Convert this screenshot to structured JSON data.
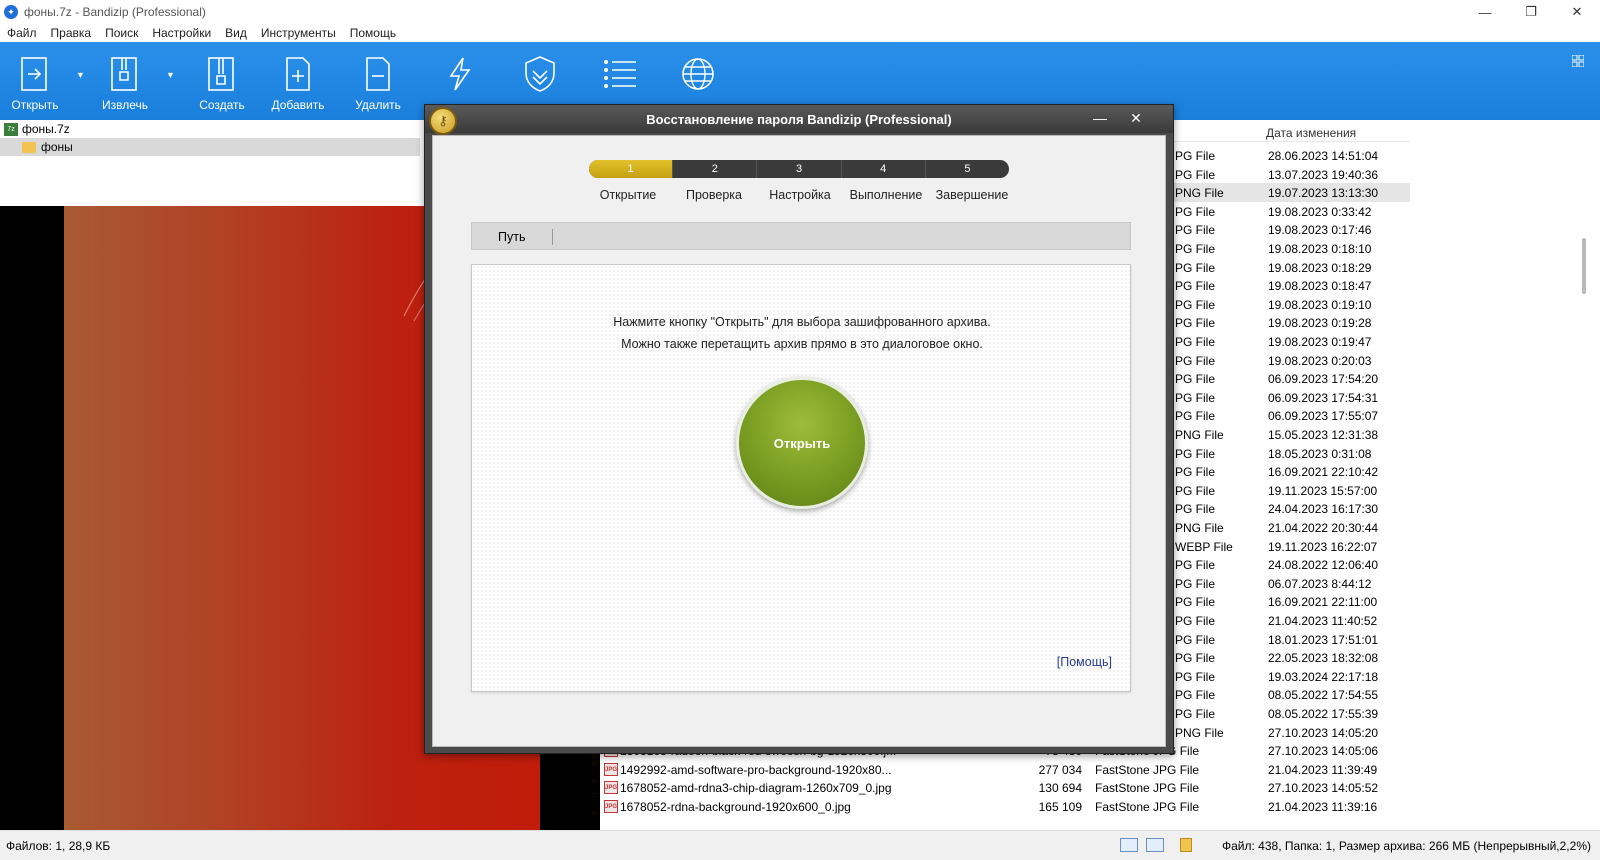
{
  "window": {
    "title": "фоны.7z - Bandizip (Professional)",
    "controls": {
      "minimize": "—",
      "restore": "❐",
      "close": "✕"
    }
  },
  "menu": [
    "Файл",
    "Правка",
    "Поиск",
    "Настройки",
    "Вид",
    "Инструменты",
    "Помощь"
  ],
  "toolbar": {
    "open": "Открыть",
    "extract": "Извлечь",
    "create": "Создать",
    "add": "Добавить",
    "delete": "Удалить"
  },
  "tree": {
    "archive": "фоны.7z",
    "folder": "фоны"
  },
  "filelist": {
    "date_header": "Дата изменения",
    "type_dates": [
      {
        "type": "PG File",
        "date": "28.06.2023 14:51:04"
      },
      {
        "type": "PG File",
        "date": "13.07.2023 19:40:36"
      },
      {
        "type": "PNG File",
        "date": "19.07.2023 13:13:30"
      },
      {
        "type": "PG File",
        "date": "19.08.2023 0:33:42"
      },
      {
        "type": "PG File",
        "date": "19.08.2023 0:17:46"
      },
      {
        "type": "PG File",
        "date": "19.08.2023 0:18:10"
      },
      {
        "type": "PG File",
        "date": "19.08.2023 0:18:29"
      },
      {
        "type": "PG File",
        "date": "19.08.2023 0:18:47"
      },
      {
        "type": "PG File",
        "date": "19.08.2023 0:19:10"
      },
      {
        "type": "PG File",
        "date": "19.08.2023 0:19:28"
      },
      {
        "type": "PG File",
        "date": "19.08.2023 0:19:47"
      },
      {
        "type": "PG File",
        "date": "19.08.2023 0:20:03"
      },
      {
        "type": "PG File",
        "date": "06.09.2023 17:54:20"
      },
      {
        "type": "PG File",
        "date": "06.09.2023 17:54:31"
      },
      {
        "type": "PG File",
        "date": "06.09.2023 17:55:07"
      },
      {
        "type": "PNG File",
        "date": "15.05.2023 12:31:38"
      },
      {
        "type": "PG File",
        "date": "18.05.2023 0:31:08"
      },
      {
        "type": "PG File",
        "date": "16.09.2021 22:10:42"
      },
      {
        "type": "PG File",
        "date": "19.11.2023 15:57:00"
      },
      {
        "type": "PG File",
        "date": "24.04.2023 16:17:30"
      },
      {
        "type": "PNG File",
        "date": "21.04.2022 20:30:44"
      },
      {
        "type": "WEBP File",
        "date": "19.11.2023 16:22:07"
      },
      {
        "type": "PG File",
        "date": "24.08.2022 12:06:40"
      },
      {
        "type": "PG File",
        "date": "06.07.2023 8:44:12"
      },
      {
        "type": "PG File",
        "date": "16.09.2021 22:11:00"
      },
      {
        "type": "PG File",
        "date": "21.04.2023 11:40:52"
      },
      {
        "type": "PG File",
        "date": "18.01.2023 17:51:01"
      },
      {
        "type": "PG File",
        "date": "22.05.2023 18:32:08"
      },
      {
        "type": "PG File",
        "date": "19.03.2024 22:17:18"
      },
      {
        "type": "PG File",
        "date": "08.05.2022 17:54:55"
      },
      {
        "type": "PG File",
        "date": "08.05.2022 17:55:39"
      },
      {
        "type": "PNG File",
        "date": "27.10.2023 14:05:20"
      }
    ],
    "full_rows": [
      {
        "name": "1303168-radeon-black-red-swoosh-bg-1920x800.j...",
        "size": "78 430",
        "type": "FastStone JPG File",
        "date": "27.10.2023 14:05:06"
      },
      {
        "name": "1492992-amd-software-pro-background-1920x80...",
        "size": "277 034",
        "type": "FastStone JPG File",
        "date": "21.04.2023 11:39:49"
      },
      {
        "name": "1678052-amd-rdna3-chip-diagram-1260x709_0.jpg",
        "size": "130 694",
        "type": "FastStone JPG File",
        "date": "27.10.2023 14:05:52"
      },
      {
        "name": "1678052-rdna-background-1920x600_0.jpg",
        "size": "165 109",
        "type": "FastStone JPG File",
        "date": "21.04.2023 11:39:16"
      }
    ]
  },
  "status": {
    "left": "Файлов: 1, 28,9 КБ",
    "right": "Файл: 438, Папка: 1, Размер архива: 266 МБ (Непрерывный,2,2%)"
  },
  "dialog": {
    "title": "Восстановление пароля Bandizip (Professional)",
    "min": "—",
    "close": "✕",
    "steps": [
      {
        "num": "1",
        "label": "Открытие"
      },
      {
        "num": "2",
        "label": "Проверка"
      },
      {
        "num": "3",
        "label": "Настройка"
      },
      {
        "num": "4",
        "label": "Выполнение"
      },
      {
        "num": "5",
        "label": "Завершение"
      }
    ],
    "path_label": "Путь",
    "msg1": "Нажмите кнопку \"Открыть\" для выбора зашифрованного архива.",
    "msg2": "Можно также перетащить архив прямо в это диалоговое окно.",
    "open_button": "Открыть",
    "help_link": "[Помощь]"
  }
}
